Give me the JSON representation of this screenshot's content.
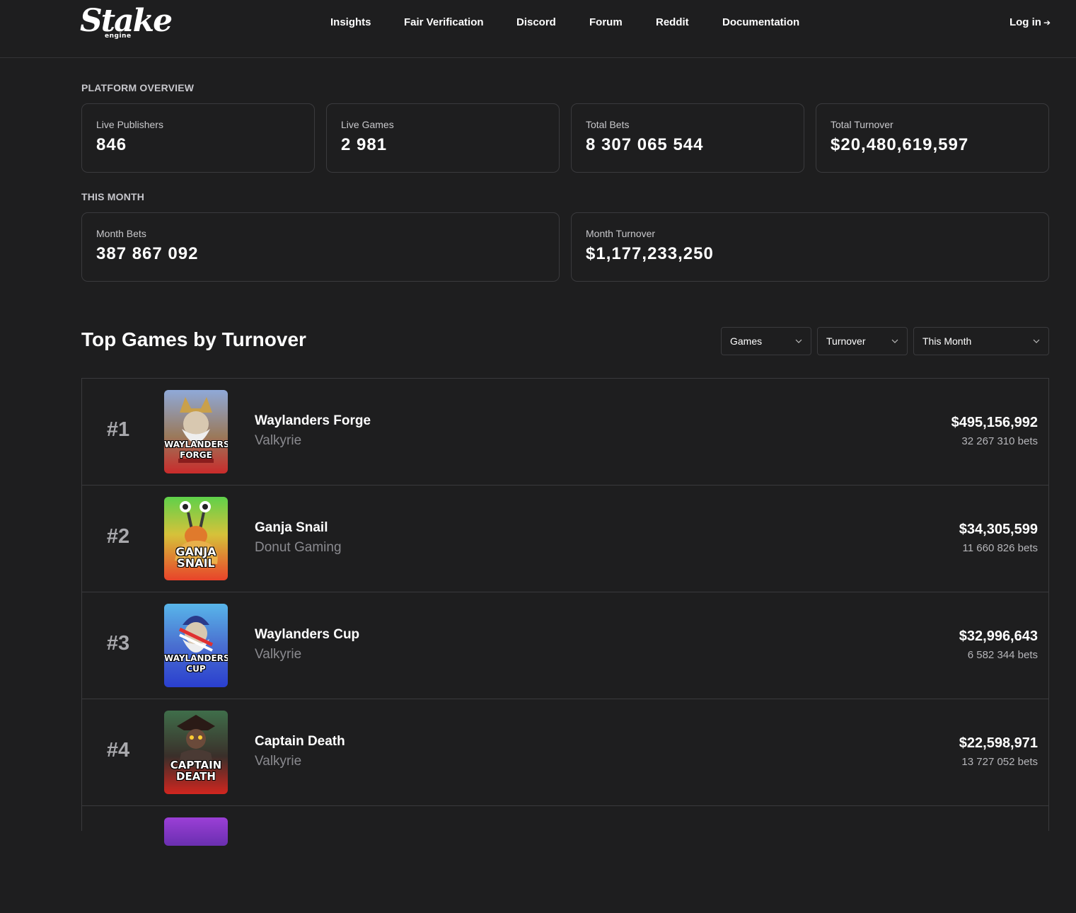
{
  "header": {
    "logo_text": "Stake",
    "logo_sub": "engine",
    "nav": [
      "Insights",
      "Fair Verification",
      "Discord",
      "Forum",
      "Reddit",
      "Documentation"
    ],
    "login_label": "Log in",
    "login_arrow": "➔"
  },
  "overview": {
    "title": "PLATFORM OVERVIEW",
    "cards": [
      {
        "label": "Live Publishers",
        "value": "846"
      },
      {
        "label": "Live Games",
        "value": "2 981"
      },
      {
        "label": "Total Bets",
        "value": "8 307 065 544"
      },
      {
        "label": "Total Turnover",
        "value": "$20,480,619,597"
      }
    ]
  },
  "month": {
    "title": "THIS MONTH",
    "cards": [
      {
        "label": "Month Bets",
        "value": "387 867 092"
      },
      {
        "label": "Month Turnover",
        "value": "$1,177,233,250"
      }
    ]
  },
  "top": {
    "heading": "Top Games by Turnover",
    "filters": {
      "category": "Games",
      "metric": "Turnover",
      "period": "This Month"
    },
    "games": [
      {
        "rank": "#1",
        "name": "Waylanders Forge",
        "publisher": "Valkyrie",
        "amount": "$495,156,992",
        "bets": "32 267 310 bets",
        "art_l1": "WAYLANDERS",
        "art_l2": "FORGE",
        "art_top": "#8fa9d8",
        "art_bottom": "#c92b2b"
      },
      {
        "rank": "#2",
        "name": "Ganja Snail",
        "publisher": "Donut Gaming",
        "amount": "$34,305,599",
        "bets": "11 660 826 bets",
        "art_l1": "GANJA",
        "art_l2": "SNAIL",
        "art_top": "#5fd14a",
        "art_bottom": "#e8432a"
      },
      {
        "rank": "#3",
        "name": "Waylanders Cup",
        "publisher": "Valkyrie",
        "amount": "$32,996,643",
        "bets": "6 582 344 bets",
        "art_l1": "WAYLANDERS",
        "art_l2": "CUP",
        "art_top": "#58b6ea",
        "art_bottom": "#2a3fcf"
      },
      {
        "rank": "#4",
        "name": "Captain Death",
        "publisher": "Valkyrie",
        "amount": "$22,598,971",
        "bets": "13 727 052 bets",
        "art_l1": "CAPTAIN",
        "art_l2": "DEATH",
        "art_top": "#3f6e4a",
        "art_bottom": "#d2261f"
      }
    ]
  }
}
